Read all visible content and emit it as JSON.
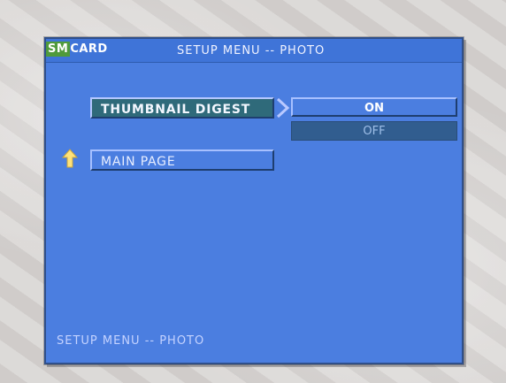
{
  "header": {
    "source_sm": "SM",
    "source_card": "CARD",
    "title": "SETUP MENU -- PHOTO"
  },
  "menu": {
    "thumbnail_label": "THUMBNAIL DIGEST",
    "main_page_label": "MAIN PAGE"
  },
  "options": {
    "on_label": "ON",
    "off_label": "OFF",
    "selected": "ON"
  },
  "footer": {
    "status_text": "SETUP MENU -- PHOTO"
  },
  "colors": {
    "screen_blue": "#4b7ee0",
    "highlight_teal": "#2f6a7a",
    "off_option": "#315d8f",
    "arrow_yellow": "#ffe27a"
  },
  "icons": {
    "submenu_arrow": "chevron-right-icon",
    "return_arrow": "up-arrow-icon"
  }
}
